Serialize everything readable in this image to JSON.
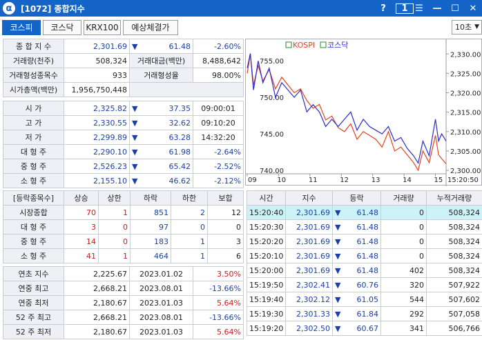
{
  "window": {
    "title": "[1072] 종합지수",
    "help": "?",
    "pane": "1",
    "menu": "☰",
    "minimize": "—",
    "maximize": "☐",
    "close": "✕"
  },
  "tabs": [
    "코스피",
    "코스닥",
    "KRX100",
    "예상체결가"
  ],
  "interval": "10초",
  "summary": {
    "index_label": "종 합 지 수",
    "index_value": "2,301.69",
    "index_change": "61.48",
    "index_pct": "-2.60%",
    "vol_label": "거래량(천주)",
    "vol_value": "508,324",
    "amt_label": "거래대금(백만)",
    "amt_value": "8,488,642",
    "formed_label": "거래형성종목수",
    "formed_value": "933",
    "formed_rate_label": "거래형성율",
    "formed_rate_value": "98.00%",
    "mcap_label": "시가총액(백만)",
    "mcap_value": "1,956,750,448"
  },
  "prices": [
    {
      "label": "시    가",
      "value": "2,325.82",
      "change": "37.35",
      "time": "09:00:01"
    },
    {
      "label": "고    가",
      "value": "2,330.55",
      "change": "32.62",
      "time": "09:10:20"
    },
    {
      "label": "저    가",
      "value": "2,299.89",
      "change": "63.28",
      "time": "14:32:20"
    },
    {
      "label": "대 형 주",
      "value": "2,290.10",
      "change": "61.98",
      "time": "-2.64%"
    },
    {
      "label": "중 형 주",
      "value": "2,526.23",
      "change": "65.42",
      "time": "-2.52%"
    },
    {
      "label": "소 형 주",
      "value": "2,155.10",
      "change": "46.62",
      "time": "-2.12%"
    }
  ],
  "breadth": {
    "headers": [
      "[등락종목수]",
      "상승",
      "상한",
      "하락",
      "하한",
      "보합"
    ],
    "rows": [
      {
        "label": "시장종합",
        "up": "70",
        "upper": "1",
        "down": "851",
        "lower": "2",
        "flat": "12"
      },
      {
        "label": "대 형 주",
        "up": "3",
        "upper": "0",
        "down": "97",
        "lower": "0",
        "flat": "0"
      },
      {
        "label": "중 형 주",
        "up": "14",
        "upper": "0",
        "down": "183",
        "lower": "1",
        "flat": "3"
      },
      {
        "label": "소 형 주",
        "up": "41",
        "upper": "1",
        "down": "464",
        "lower": "1",
        "flat": "6"
      }
    ]
  },
  "yearly": [
    {
      "label": "연초  지수",
      "value": "2,225.67",
      "date": "2023.01.02",
      "pct": "3.50%"
    },
    {
      "label": "연중  최고",
      "value": "2,668.21",
      "date": "2023.08.01",
      "pct": "-13.66%"
    },
    {
      "label": "연중  최저",
      "value": "2,180.67",
      "date": "2023.01.03",
      "pct": "5.64%"
    },
    {
      "label": "52 주 최고",
      "value": "2,668.21",
      "date": "2023.08.01",
      "pct": "-13.66%"
    },
    {
      "label": "52 주 최저",
      "value": "2,180.67",
      "date": "2023.01.03",
      "pct": "5.64%"
    }
  ],
  "ticks": {
    "headers": [
      "시간",
      "지수",
      "등락",
      "거래량",
      "누적거래량"
    ],
    "rows": [
      {
        "time": "15:20:40",
        "index": "2,301.69",
        "change": "61.48",
        "vol": "0",
        "cum": "508,324"
      },
      {
        "time": "15:20:30",
        "index": "2,301.69",
        "change": "61.48",
        "vol": "0",
        "cum": "508,324"
      },
      {
        "time": "15:20:20",
        "index": "2,301.69",
        "change": "61.48",
        "vol": "0",
        "cum": "508,324"
      },
      {
        "time": "15:20:10",
        "index": "2,301.69",
        "change": "61.48",
        "vol": "0",
        "cum": "508,324"
      },
      {
        "time": "15:20:00",
        "index": "2,301.69",
        "change": "61.48",
        "vol": "402",
        "cum": "508,324"
      },
      {
        "time": "15:19:50",
        "index": "2,302.41",
        "change": "60.76",
        "vol": "320",
        "cum": "507,922"
      },
      {
        "time": "15:19:40",
        "index": "2,302.12",
        "change": "61.05",
        "vol": "544",
        "cum": "507,602"
      },
      {
        "time": "15:19:30",
        "index": "2,301.33",
        "change": "61.84",
        "vol": "292",
        "cum": "507,058"
      },
      {
        "time": "15:19:20",
        "index": "2,302.50",
        "change": "60.67",
        "vol": "341",
        "cum": "506,766"
      }
    ]
  },
  "colors": {
    "accent": "#1565c8",
    "kospi": "#e8401c",
    "kosdaq": "#2a2ad0",
    "up": "#d01818",
    "down": "#1a3fa6",
    "highlight": "#cdf3f8"
  },
  "chart_data": {
    "type": "line",
    "legend": [
      "KOSPI",
      "코스닥"
    ],
    "left_ticks": [
      "755.00",
      "750.00",
      "745.00",
      "740.00"
    ],
    "right_ticks": [
      "2,330.00",
      "2,325.00",
      "2,320.00",
      "2,315.00",
      "2,310.00",
      "2,305.00",
      "2,300.00"
    ],
    "x_ticks": [
      "09",
      "10",
      "11",
      "12",
      "13",
      "14",
      "15",
      "15:20:50"
    ],
    "ylim_left": [
      740,
      757
    ],
    "ylim_right": [
      2300,
      2332
    ],
    "xlim": [
      9.0,
      15.34
    ],
    "series": [
      {
        "name": "KOSPI",
        "axis": "right",
        "x": [
          9.0,
          9.1,
          9.2,
          9.35,
          9.5,
          9.7,
          9.9,
          10.1,
          10.3,
          10.5,
          10.7,
          10.9,
          11.1,
          11.3,
          11.5,
          11.7,
          11.9,
          12.1,
          12.3,
          12.5,
          12.7,
          12.9,
          13.1,
          13.3,
          13.5,
          13.7,
          13.9,
          14.1,
          14.3,
          14.45,
          14.6,
          14.8,
          15.0,
          15.1,
          15.2,
          15.34
        ],
        "y": [
          2325,
          2330,
          2322,
          2327,
          2323,
          2326,
          2321,
          2324,
          2322,
          2320,
          2321,
          2318,
          2316,
          2317,
          2313,
          2314,
          2311,
          2310,
          2312,
          2308,
          2310,
          2309,
          2308,
          2306,
          2310,
          2305,
          2306,
          2304,
          2302,
          2300,
          2305,
          2302,
          2309,
          2304,
          2303,
          2301.69
        ]
      },
      {
        "name": "코스닥",
        "axis": "left",
        "x": [
          9.0,
          9.1,
          9.2,
          9.35,
          9.5,
          9.7,
          9.9,
          10.1,
          10.3,
          10.5,
          10.7,
          10.9,
          11.1,
          11.3,
          11.5,
          11.7,
          11.9,
          12.1,
          12.3,
          12.5,
          12.7,
          12.9,
          13.1,
          13.3,
          13.5,
          13.7,
          13.9,
          14.1,
          14.3,
          14.45,
          14.6,
          14.8,
          15.0,
          15.1,
          15.2,
          15.34
        ],
        "y": [
          754,
          756,
          751,
          755,
          752,
          754,
          750,
          752,
          751,
          750,
          751,
          748,
          749,
          748,
          746,
          747,
          746,
          747,
          748,
          745.5,
          747,
          746,
          745.5,
          745,
          746,
          744,
          744.5,
          743,
          742,
          741,
          744,
          742,
          747,
          744,
          745,
          744
        ]
      }
    ]
  }
}
